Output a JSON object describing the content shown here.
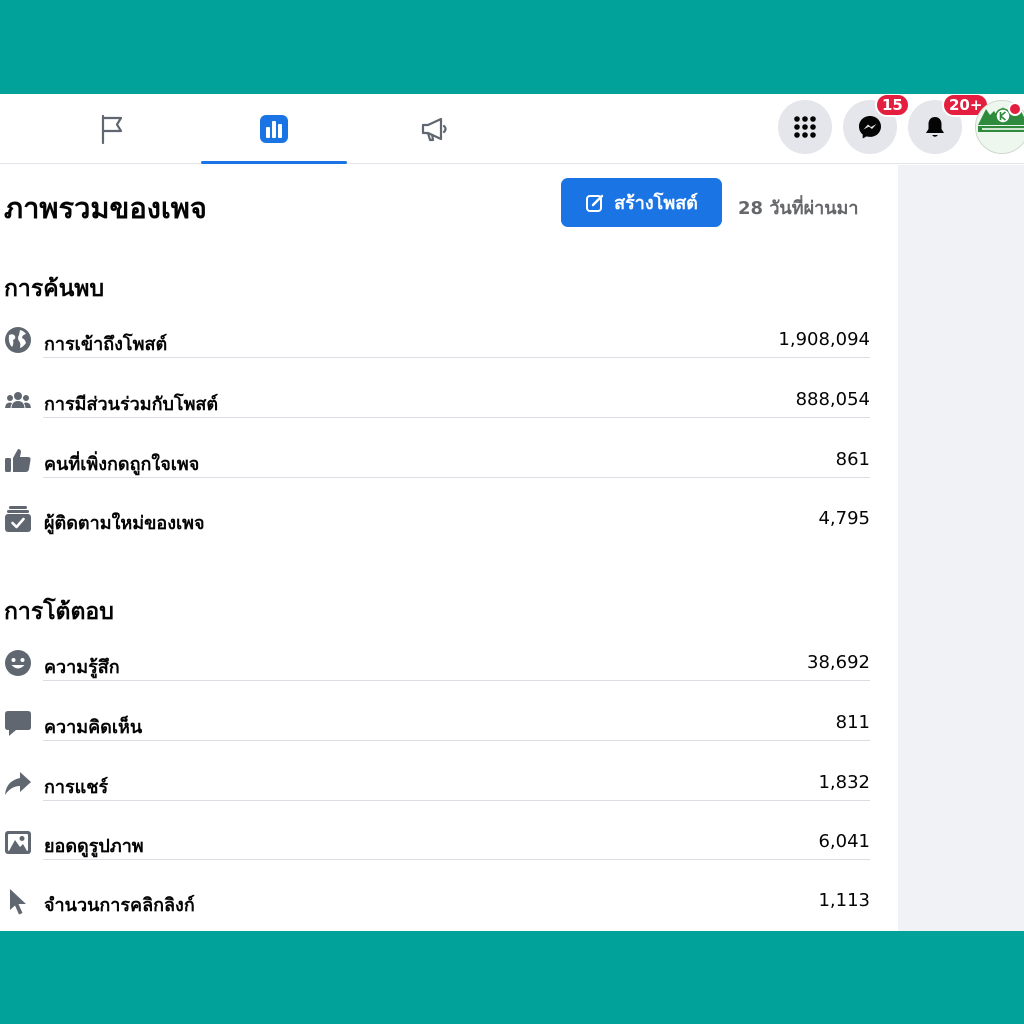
{
  "nav": {
    "tabs": [
      {
        "icon": "flag-icon"
      },
      {
        "icon": "bar-chart-icon",
        "active": true
      },
      {
        "icon": "megaphone-icon"
      }
    ],
    "actions": {
      "menu_icon": "grid-menu-icon",
      "messenger_badge": "15",
      "notifications_badge": "20+"
    }
  },
  "header": {
    "title": "ภาพรวมของเพจ",
    "create_post_label": "สร้างโพสต์",
    "date_range": "28 วันที่ผ่านมา"
  },
  "discovery": {
    "title": "การค้นพบ",
    "items": [
      {
        "icon": "globe-icon",
        "label": "การเข้าถึงโพสต์",
        "value": "1,908,094"
      },
      {
        "icon": "people-icon",
        "label": "การมีส่วนร่วมกับโพสต์",
        "value": "888,054"
      },
      {
        "icon": "thumbs-up-icon",
        "label": "คนที่เพิ่งกดถูกใจเพจ",
        "value": "861"
      },
      {
        "icon": "follow-inbox-icon",
        "label": "ผู้ติดตามใหม่ของเพจ",
        "value": "4,795"
      }
    ]
  },
  "interactions": {
    "title": "การโต้ตอบ",
    "items": [
      {
        "icon": "smiley-icon",
        "label": "ความรู้สึก",
        "value": "38,692"
      },
      {
        "icon": "comment-icon",
        "label": "ความคิดเห็น",
        "value": "811"
      },
      {
        "icon": "share-icon",
        "label": "การแชร์",
        "value": "1,832"
      },
      {
        "icon": "photo-icon",
        "label": "ยอดดูรูปภาพ",
        "value": "6,041"
      },
      {
        "icon": "cursor-icon",
        "label": "จำนวนการคลิกลิงก์",
        "value": "1,113"
      }
    ]
  },
  "colors": {
    "background_teal": "#00a29a",
    "accent_blue": "#1b74e4",
    "badge_red": "#e41e3f",
    "icon_gray": "#606770"
  }
}
